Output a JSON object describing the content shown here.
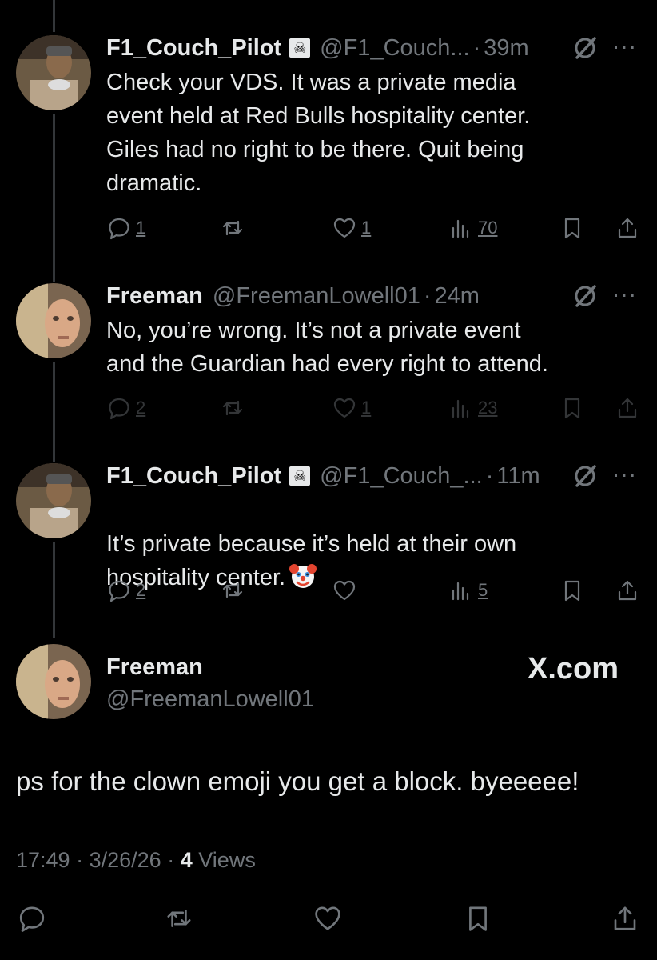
{
  "replies": [
    {
      "name": "F1_Couch_Pilot",
      "flag_icon": "pirate-flag",
      "handle": "@F1_Couch...",
      "time": "39m",
      "text": "Check your VDS. It was a private media\nevent held at Red Bulls hospitality center.\nGiles had no right to be there. Quit being\ndramatic.",
      "replies": "1",
      "likes": "1",
      "views": "70"
    },
    {
      "name": "Freeman",
      "handle": "@FreemanLowell01",
      "time": "24m",
      "text": "No, you’re wrong.  It’s not a private event\nand the Guardian had every right to attend.",
      "replies": "2",
      "likes": "1",
      "views": "23"
    },
    {
      "name": "F1_Couch_Pilot",
      "flag_icon": "pirate-flag",
      "handle": "@F1_Couch_...",
      "time": "11m",
      "text_line1": "It’s private because it’s held at their own",
      "text_line2": "hospitality center.",
      "replies": "2",
      "views": "5"
    }
  ],
  "main_post": {
    "name": "Freeman",
    "handle": "@FreemanLowell01",
    "watermark": "X.com",
    "text": "ps for the clown emoji you get a block. byeeeee!",
    "time": "17:49",
    "date": "3/26/26",
    "views_count": "4",
    "views_label": "Views"
  },
  "separator": "·",
  "more_label": "···"
}
